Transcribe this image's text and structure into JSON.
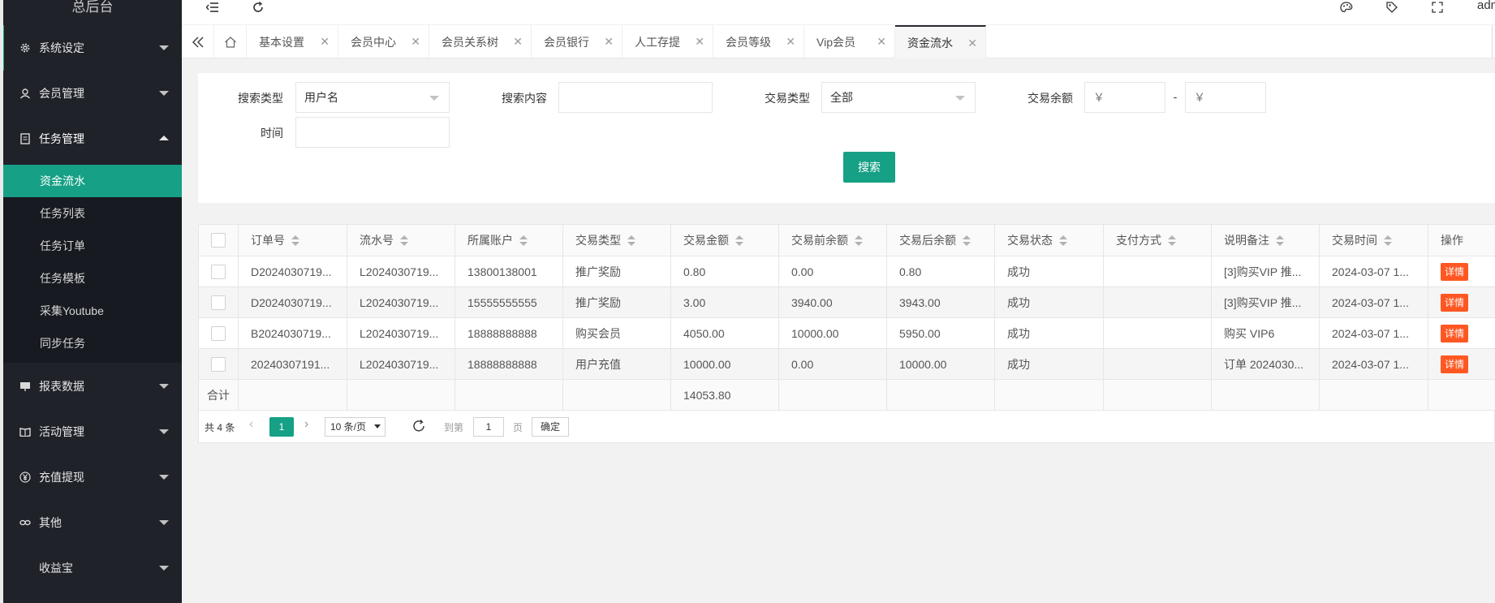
{
  "logo": "总后台",
  "sidebar": {
    "items": [
      {
        "label": "系统设定",
        "icon": "gear-icon"
      },
      {
        "label": "会员管理",
        "icon": "user-icon"
      },
      {
        "label": "任务管理",
        "icon": "document-icon"
      },
      {
        "label": "报表数据",
        "icon": "report-icon"
      },
      {
        "label": "活动管理",
        "icon": "book-icon"
      },
      {
        "label": "充值提现",
        "icon": "yen-icon"
      },
      {
        "label": "其他",
        "icon": "link-icon"
      },
      {
        "label": "收益宝",
        "icon": ""
      }
    ],
    "sub_items": [
      "资金流水",
      "任务列表",
      "任务订单",
      "任务模板",
      "采集Youtube",
      "同步任务"
    ]
  },
  "topbar": {
    "user": "adm"
  },
  "tabs": [
    "基本设置",
    "会员中心",
    "会员关系树",
    "会员银行",
    "人工存提",
    "会员等级",
    "Vip会员",
    "资金流水"
  ],
  "form": {
    "search_type_label": "搜索类型",
    "search_type_value": "用户名",
    "search_content_label": "搜索内容",
    "trade_type_label": "交易类型",
    "trade_type_value": "全部",
    "balance_label": "交易余额",
    "balance_min_placeholder": "￥",
    "balance_max_placeholder": "￥",
    "range_sep": "-",
    "time_label": "时间",
    "search_button": "搜索"
  },
  "table": {
    "headers": [
      "订单号",
      "流水号",
      "所属账户",
      "交易类型",
      "交易金额",
      "交易前余额",
      "交易后余额",
      "交易状态",
      "支付方式",
      "说明备注",
      "交易时间",
      "操作"
    ],
    "rows": [
      [
        "D2024030719...",
        "L2024030719...",
        "13800138001",
        "推广奖励",
        "0.80",
        "0.00",
        "0.80",
        "成功",
        "",
        "[3]购买VIP 推...",
        "2024-03-07 1..."
      ],
      [
        "D2024030719...",
        "L2024030719...",
        "15555555555",
        "推广奖励",
        "3.00",
        "3940.00",
        "3943.00",
        "成功",
        "",
        "[3]购买VIP 推...",
        "2024-03-07 1..."
      ],
      [
        "B2024030719...",
        "L2024030719...",
        "18888888888",
        "购买会员",
        "4050.00",
        "10000.00",
        "5950.00",
        "成功",
        "",
        "购买 VIP6",
        "2024-03-07 1..."
      ],
      [
        "20240307191...",
        "L2024030719...",
        "18888888888",
        "用户充值",
        "10000.00",
        "0.00",
        "10000.00",
        "成功",
        "",
        "订单 2024030...",
        "2024-03-07 1..."
      ]
    ],
    "detail_label": "详情",
    "sum_label": "合计",
    "sum_amount": "14053.80"
  },
  "pager": {
    "total": "共 4 条",
    "current_page": "1",
    "page_size": "10 条/页",
    "goto_label": "到第",
    "goto_value": "1",
    "page_unit": "页",
    "confirm": "确定"
  },
  "colors": {
    "accent": "#16a085",
    "sidebar": "#20222a",
    "detail": "#ff5722"
  }
}
